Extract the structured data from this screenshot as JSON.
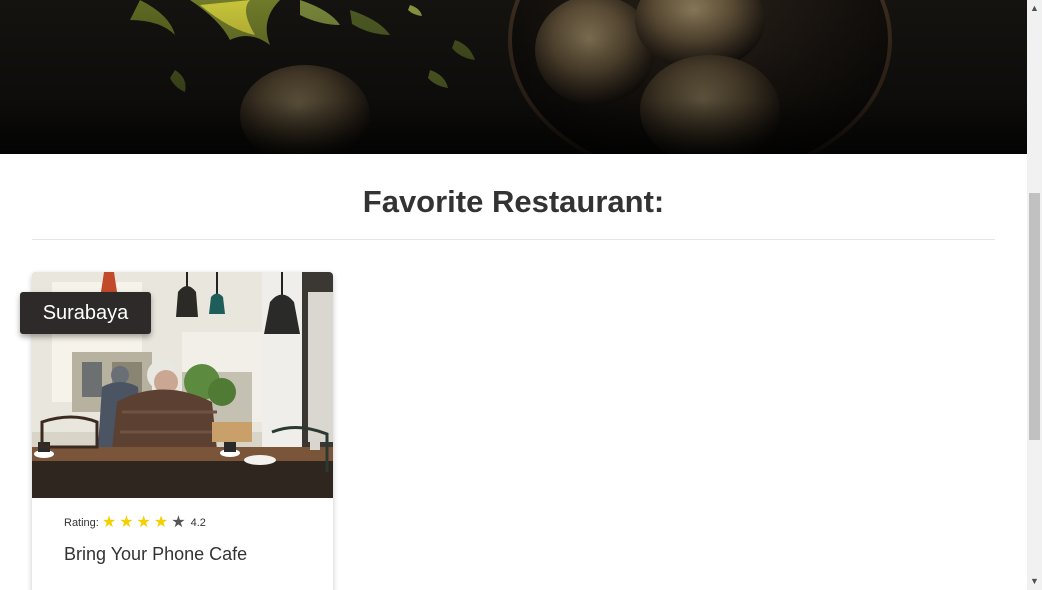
{
  "hero": {
    "caption": "",
    "image_icon": "food-hero-image"
  },
  "section": {
    "title": "Favorite Restaurant:"
  },
  "restaurants": [
    {
      "city": "Surabaya",
      "rating_label": "Rating:",
      "rating": 4.2,
      "rating_text": "4.2",
      "stars_full": 4,
      "stars_total": 5,
      "name": "Bring Your Phone Cafe",
      "image_icon": "cafe-photo"
    }
  ],
  "colors": {
    "badge_bg": "#2e2a29",
    "star_full": "#f5d000",
    "star_empty": "#555555",
    "title_text": "#333333"
  },
  "icons": {
    "star": "★",
    "scroll_up": "▲",
    "scroll_down": "▼"
  }
}
